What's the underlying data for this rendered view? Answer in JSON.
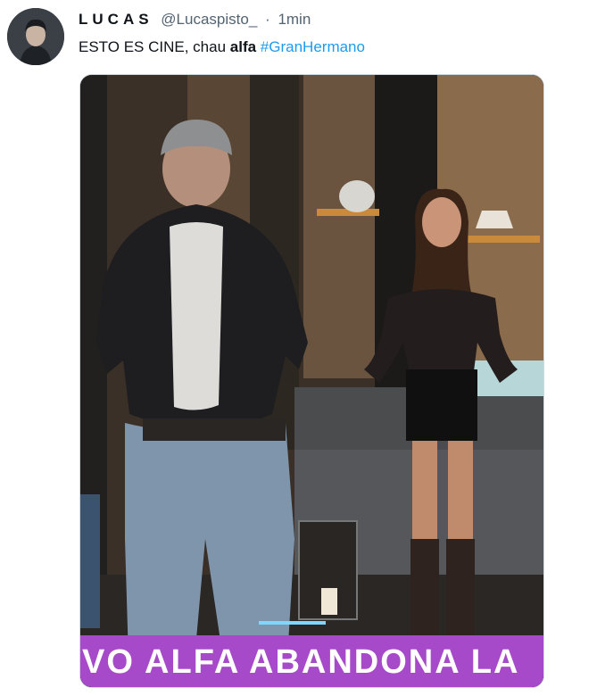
{
  "tweet": {
    "author": {
      "name": "LUCAS",
      "handle": "@Lucaspisto_",
      "separator": "·",
      "time": "1min"
    },
    "text": {
      "part1": "ESTO ES CINE, chau ",
      "bold": "alfa",
      "space": " ",
      "hashtag": "#GranHermano"
    },
    "media": {
      "banner_text": "VO  ALFA ABANDONA LA",
      "banner_color": "#a64ac9"
    }
  }
}
